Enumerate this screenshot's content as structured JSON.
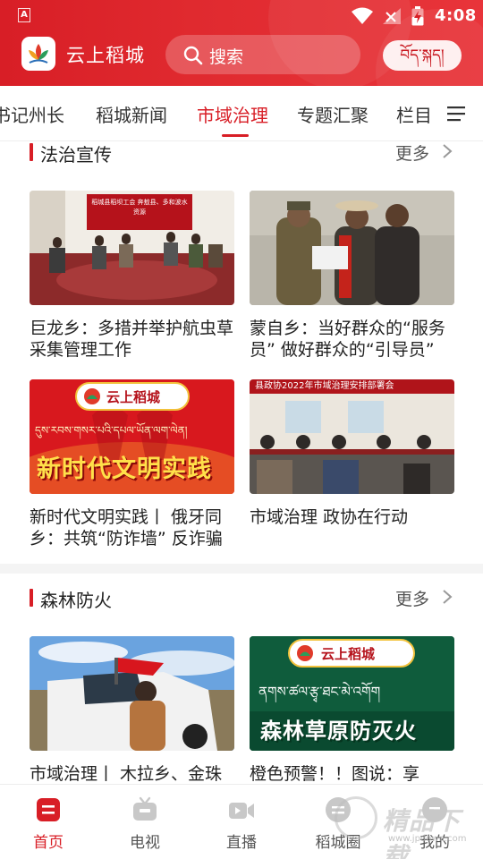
{
  "status_bar": {
    "sim_label": "A",
    "time": "4:08"
  },
  "header": {
    "app_name": "云上稻城",
    "search_placeholder": "搜索",
    "tibetan_button": "བོད་སྐད།"
  },
  "tabs": [
    {
      "label": "书记州长",
      "visible": "书记州长"
    },
    {
      "label": "稻城新闻"
    },
    {
      "label": "市域治理",
      "active": true
    },
    {
      "label": "专题汇聚"
    },
    {
      "label": "栏目"
    }
  ],
  "sections": [
    {
      "title": "法治宣传",
      "more": "更多",
      "cards": [
        {
          "caption": "巨龙乡：多措并举护航虫草采集管理工作",
          "banner": "稻城县稻坝工会 奔敖县、多和波水资源"
        },
        {
          "caption": "蒙自乡：当好群众的“服务员” 做好群众的“引导员”"
        },
        {
          "caption": "新时代文明实践丨 俄牙同乡：共筑“防诈墙” 反诈骗",
          "logo_text": "云上稻城",
          "poster_text": "新时代文明实践",
          "poster_tibetan": "དུས་རབས་གསར་པའི་དཔལ་ཡོན་ལག་ལེན།"
        },
        {
          "caption": "市域治理 政协在行动",
          "banner": "县政协2022年市域治理安排部署会"
        }
      ]
    },
    {
      "title": "森林防火",
      "more": "更多",
      "cards": [
        {
          "caption": "市域治理丨 木拉乡、金珠镇开展"
        },
        {
          "caption": "橙色预警！！图说：享",
          "logo_text": "云上稻城",
          "poster_text": "森林草原防灭火",
          "poster_tibetan": "ནགས་ཚལ་རྩྭ་ཐང་མེ་འགོག"
        }
      ]
    }
  ],
  "bottom_nav": [
    {
      "label": "首页",
      "active": true
    },
    {
      "label": "电视"
    },
    {
      "label": "直播"
    },
    {
      "label": "稻城圈"
    },
    {
      "label": "我的"
    }
  ],
  "watermark": {
    "text": "精品下载",
    "sub": "www.jpdown.com"
  },
  "colors": {
    "brand_red": "#d81e26",
    "nav_gray": "#c8c8c8"
  }
}
